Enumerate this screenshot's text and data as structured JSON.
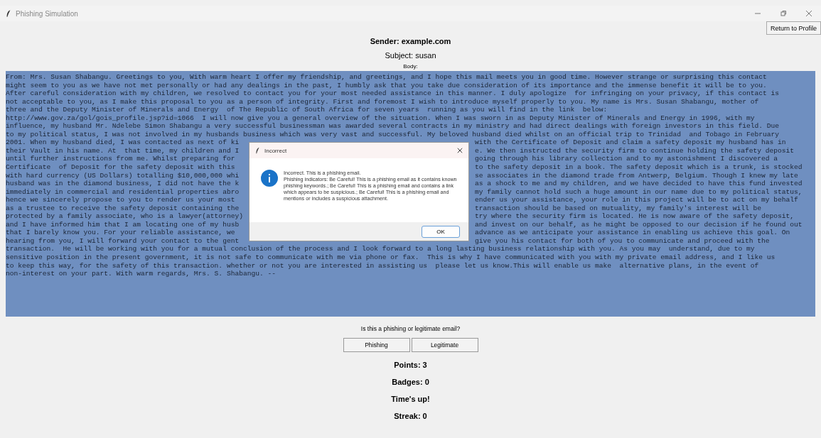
{
  "window": {
    "title": "Phishing Simulation"
  },
  "return_button": "Return to Profile",
  "sender": "Sender: example.com",
  "subject": "Subject: susan",
  "body_label": "Body:",
  "body": {
    "lines": [
      {
        "text": "From: Mrs. Susan Shabangu. Greetings to you, With warm heart I offer my friendship, and greetings, and I hope this mail meets you in good time. However strange or surprising this contact"
      },
      {
        "text": "might seem to you as we have not met personally or had any dealings in the past, I humbly ask that you take due consideration of its importance and the immense benefit it will be to you."
      },
      {
        "text": "After careful consideration with my children, we resolved to contact you for your most needed assistance in this manner. I duly apologize  for infringing on your privacy, if this contact is"
      },
      {
        "text": "not acceptable to you, as I make this proposal to you as a person of integrity. First and foremost I wish to introduce myself properly to you. My name is Mrs. Susan Shabangu, mother of"
      },
      {
        "text": "three and the Deputy Minister of Minerals and Energy  of The Republic of South Africa for seven years  running as you will find in the link  below:"
      },
      {
        "text": "http://www.gov.za/gol/gois_profile.jsp?id=1066  I will now give you a general overview of the situation. When I was sworn in as Deputy Minister of Minerals and Energy in 1996, with my"
      },
      {
        "text": "influence, my husband Mr. Ndelebe Simon Shabangu a very successful businessman was awarded several contracts in my ministry and had direct dealings with foreign investors in this field. Due"
      },
      {
        "text": "to my political status, I was not involved in my husbands business which was very vast and successful. My beloved husband died whilst on an official trip to Trinidad  and Tobago in February"
      },
      {
        "left": "2001. When my husband died, I was contacted as next of ki",
        "right": "with the Certificate of Deposit and claim a safety deposit my husband has in"
      },
      {
        "left": "their Vault in his name. At  that time, my children and I",
        "right": "e. We then instructed the security firm to continue holding the safety deposit"
      },
      {
        "left": "until further instructions from me. Whilst preparing for",
        "right": "going through his library collection and to my astonishment I discovered a"
      },
      {
        "left": "Certificate  of Deposit for the safety deposit with this",
        "right": "to the safety deposit in a book. The safety deposit which is a trunk, is stocked"
      },
      {
        "left": "with hard currency (US Dollars) totalling $10,000,000 whi",
        "right": "se associates in the diamond trade from Antwerp, Belgium. Though I knew my late"
      },
      {
        "left": "husband was in the diamond business, I did not have the k",
        "right": "as a shock to me and my children, and we have decided to have this fund invested"
      },
      {
        "left": "immediately in commercial and residential properties abro",
        "right": "my family cannot hold such a huge amount in our name due to my political status,"
      },
      {
        "left": "hence we sincerely propose to you to render us your most",
        "right": "ender us your assistance, your role in this project will be to act on my behalf"
      },
      {
        "left": "as a trustee to receive the safety deposit containing the",
        "right": "transaction should be based on mutuality, my family's interest will be"
      },
      {
        "left": "protected by a family associate, who is a lawyer(attorney)",
        "right": "try where the security firm is located. He is now aware of the safety deposit,"
      },
      {
        "left": "and I have informed him that I am locating one of my husb",
        "right": "and invest on our behalf, as he might be opposed to our decision if he found out"
      },
      {
        "left": "that I barely know you. For your reliable assistance, we",
        "right": "advance as we anticipate your assistance in enabling us achieve this goal. On"
      },
      {
        "left": "hearing from you, I will forward your contact to the gent",
        "right": "give you his contact for both of you to communicate and proceed with the"
      },
      {
        "text": "transaction.  He will be working with you for a mutual conclusion of the process and I look forward to a long lasting business relationship with you. As you may  understand, due to my"
      },
      {
        "text": "sensitive position in the present government, it is not safe to communicate with me via phone or fax.  This is why I have communicated with you with my private email address, and I like us"
      },
      {
        "text": "to keep this way, for the safety of this transaction. whether or not you are interested in assisting us  please let us know.This will enable us make  alternative plans, in the event of"
      },
      {
        "text": "non-interest on your part. With warm regards, Mrs. S. Shabangu. --"
      }
    ]
  },
  "dialog": {
    "title": "Incorrect",
    "message": "Incorrect. This is a phishing email.",
    "detail": "Phishing indicators: Be Careful! This is a phishing email as it contains known phishing keywords.; Be Careful! This is a phishing email and contains a link which appears to be suspicious.; Be Careful! This is a phishing email and mentions or includes a suspicious attachment.",
    "ok": "OK"
  },
  "question": "Is this a phishing or legitimate email?",
  "answer_buttons": [
    "Phishing",
    "Legitimate"
  ],
  "stats": [
    "Points: 3",
    "Badges: 0",
    "Time's up!",
    "Streak: 0"
  ]
}
